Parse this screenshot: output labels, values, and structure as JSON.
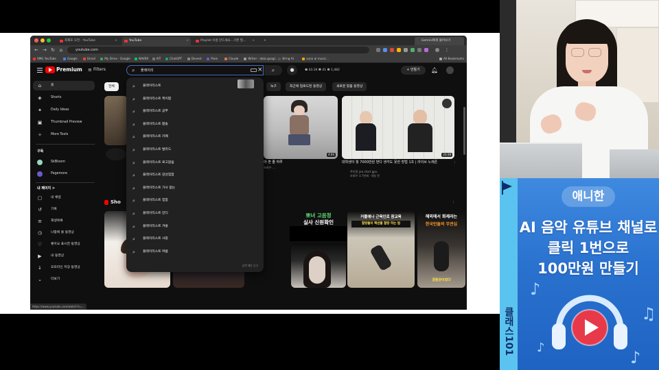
{
  "browser": {
    "tabs": [
      {
        "label": "최재호 오전 - YouTube",
        "active": false
      },
      {
        "label": "YouTube",
        "active": true
      },
      {
        "label": "Playlist 이름 만드세요...기존 필...",
        "active": false
      },
      {
        "label": "Gemini에게 물어보기",
        "active": false
      }
    ],
    "url": "youtube.com",
    "bookmarks": [
      "SMG YouTube",
      "Google",
      "Gmail",
      "My Drive - Google",
      "NAVER",
      "AIT",
      "ChatGPT",
      "Devent",
      "Pixie",
      "Claude",
      "Writer - data googl...",
      "Bring AI",
      "suno ai music...",
      "All Bookmarks"
    ],
    "status_url": "https://www.youtube.com/watch?v=..."
  },
  "youtube": {
    "brand": "Premium",
    "filters_label": "Filters",
    "search_query": "플레이리",
    "create_label": "+ 만들기",
    "stats_text": "❶ 43.1K  ❷ 41  ❸ 1,482",
    "sidebar": {
      "main_items": [
        {
          "label": "홈",
          "icon": "home-icon",
          "glyph": "⌂",
          "active": true
        },
        {
          "label": "Shorts",
          "icon": "shorts-icon",
          "glyph": "◈",
          "active": false
        },
        {
          "label": "Daily Ideas",
          "icon": "idea-icon",
          "glyph": "✦",
          "active": false
        },
        {
          "label": "Thumbnail Preview",
          "icon": "thumbnail-icon",
          "glyph": "▣",
          "active": false
        },
        {
          "label": "More Tools",
          "icon": "tools-icon",
          "glyph": "✧",
          "active": false
        }
      ],
      "subs_heading": "구독",
      "subs": [
        {
          "label": "SkBloom",
          "color": "#9ad6c2"
        },
        {
          "label": "Pagemore",
          "color": "#6a5acd"
        }
      ],
      "my_heading": "내 페이지 >",
      "my_items": [
        {
          "label": "내 채널",
          "glyph": "▢"
        },
        {
          "label": "기록",
          "glyph": "↺"
        },
        {
          "label": "재생목록",
          "glyph": "≡"
        },
        {
          "label": "나중에 볼 동영상",
          "glyph": "◷"
        },
        {
          "label": "좋아요 표시한 동영상",
          "glyph": "♡"
        },
        {
          "label": "내 동영상",
          "glyph": "▶"
        },
        {
          "label": "오프라인 저장 동영상",
          "glyph": "↓"
        },
        {
          "label": "더보기",
          "glyph": "⌄"
        }
      ]
    },
    "chips": [
      "전체",
      "녹구",
      "최근에 업로드된 동영상",
      "새로운 맞춤 동영상"
    ],
    "suggestions": [
      "플레이리스트",
      "플레이리스트 케이팝",
      "플레이리스트 공부",
      "플레이리스트 팝송",
      "플레이리스트 카페",
      "플레이리스트 발라드",
      "플레이리스트 로고없음",
      "플레이리스트 감성힙합",
      "플레이리스트 가사 없는",
      "플레이리스트 힙합",
      "플레이리스트 만디",
      "플레이리스트 겨울",
      "플레이리스트 사랑",
      "플레이리스트 여름"
    ],
    "suggestions_report": "검색 제안 신고",
    "videos": [
      {
        "title": "아 흔 줄 하루",
        "meta1": "조회수 ...",
        "meta2": "",
        "duration": "4:04"
      },
      {
        "title": "대학생이 월 7000만원 번다 생각도 못한 방법 1조 | 라이브 노래존",
        "meta1": "주인장 joo start gpu",
        "meta2": "조회수 3.7만회 · 8일 전",
        "duration": "23:38"
      }
    ],
    "shorts_heading": "Sho",
    "shorts": [
      {
        "kicker1": "이루",
        "kicker2": "위에너"
      },
      {
        "kicker1": "",
        "kicker2": ""
      },
      {
        "kicker1": "뽀녀 고음정",
        "kicker2": "실사 신원확인"
      },
      {
        "kicker1": "커플에나 근육인로 참교육",
        "kicker2": "할랑들이 팩션볼 할랑 하는 법"
      },
      {
        "kicker1": "해외에서 화제라는",
        "kicker2": "한국인들의 무관심"
      }
    ],
    "dispatch_caption": "경종관이었다"
  },
  "banner": {
    "name": "애니한",
    "line1": "AI 음악 유튜브 채널로",
    "line2": "클릭 1번으로",
    "line3": "100만원 만들기",
    "vertical": "클래스101",
    "colors": {
      "accent": "#2876d4",
      "strip": "#5bc3ef",
      "play": "#e8394a"
    }
  }
}
